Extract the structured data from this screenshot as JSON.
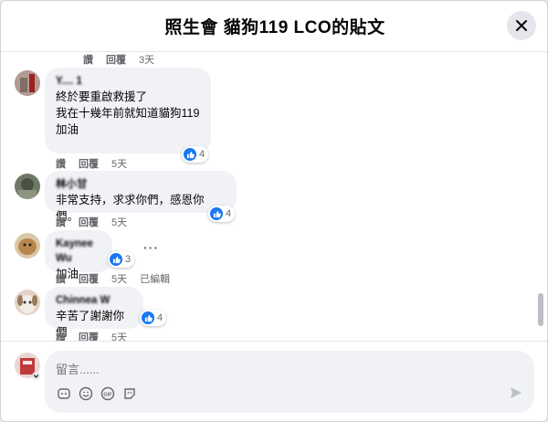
{
  "header": {
    "title": "照生會 貓狗119 LCO的貼文",
    "close_icon": "close-icon"
  },
  "top_actions": {
    "like": "讚",
    "reply": "回覆",
    "time": "3天"
  },
  "comments": [
    {
      "author": "Y.... 1",
      "lines": [
        "終於要重啟救援了",
        "我在十幾年前就知道貓狗119",
        "加油"
      ],
      "reactions": "4",
      "like": "讚",
      "reply": "回覆",
      "time": "5天"
    },
    {
      "author": "林小甘",
      "lines": [
        "非常支持，求求你們，感恩你們。"
      ],
      "reactions": "4",
      "like": "讚",
      "reply": "回覆",
      "time": "5天"
    },
    {
      "author": "Kaynee Wu",
      "lines": [
        "加油"
      ],
      "reactions": "3",
      "like": "讚",
      "reply": "回覆",
      "time": "5天",
      "edited": "已編輯"
    },
    {
      "author": "Chinnea W",
      "lines": [
        "辛苦了謝謝你們"
      ],
      "reactions": "4",
      "like": "讚",
      "reply": "回覆",
      "time": "5天"
    }
  ],
  "composer": {
    "placeholder": "留言......"
  },
  "colors": {
    "like_blue": "#1877f2",
    "bubble_bg": "#f0f2f5",
    "meta_gray": "#65676b"
  }
}
